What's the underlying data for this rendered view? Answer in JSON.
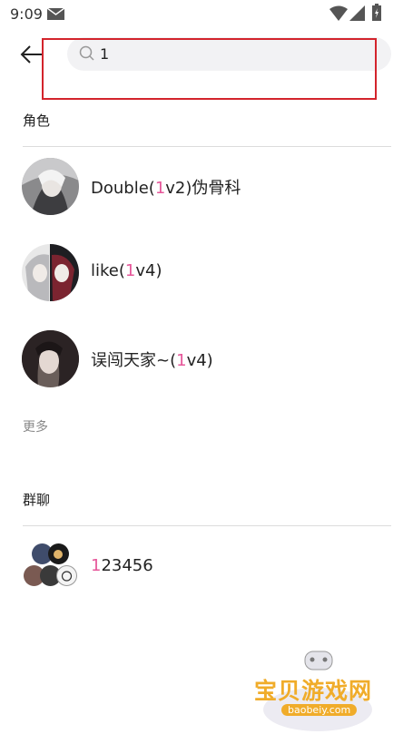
{
  "status_bar": {
    "time": "9:09"
  },
  "search": {
    "query": "1"
  },
  "sections": {
    "characters_title": "角色",
    "groups_title": "群聊",
    "more_label": "更多"
  },
  "characters": [
    {
      "prefix": "Double(",
      "match": "1",
      "suffix": "v2)伪骨科"
    },
    {
      "prefix": "like(",
      "match": "1",
      "suffix": "v4)"
    },
    {
      "prefix": "误闯天家~(",
      "match": "1",
      "suffix": "v4)"
    }
  ],
  "groups": [
    {
      "match": "1",
      "suffix": "23456"
    }
  ],
  "watermark": {
    "title": "宝贝游戏网",
    "url": "baobeiy.com"
  },
  "colors": {
    "highlight": "#e6579a",
    "frame": "#d3242c",
    "watermark": "#f0ac2a"
  }
}
